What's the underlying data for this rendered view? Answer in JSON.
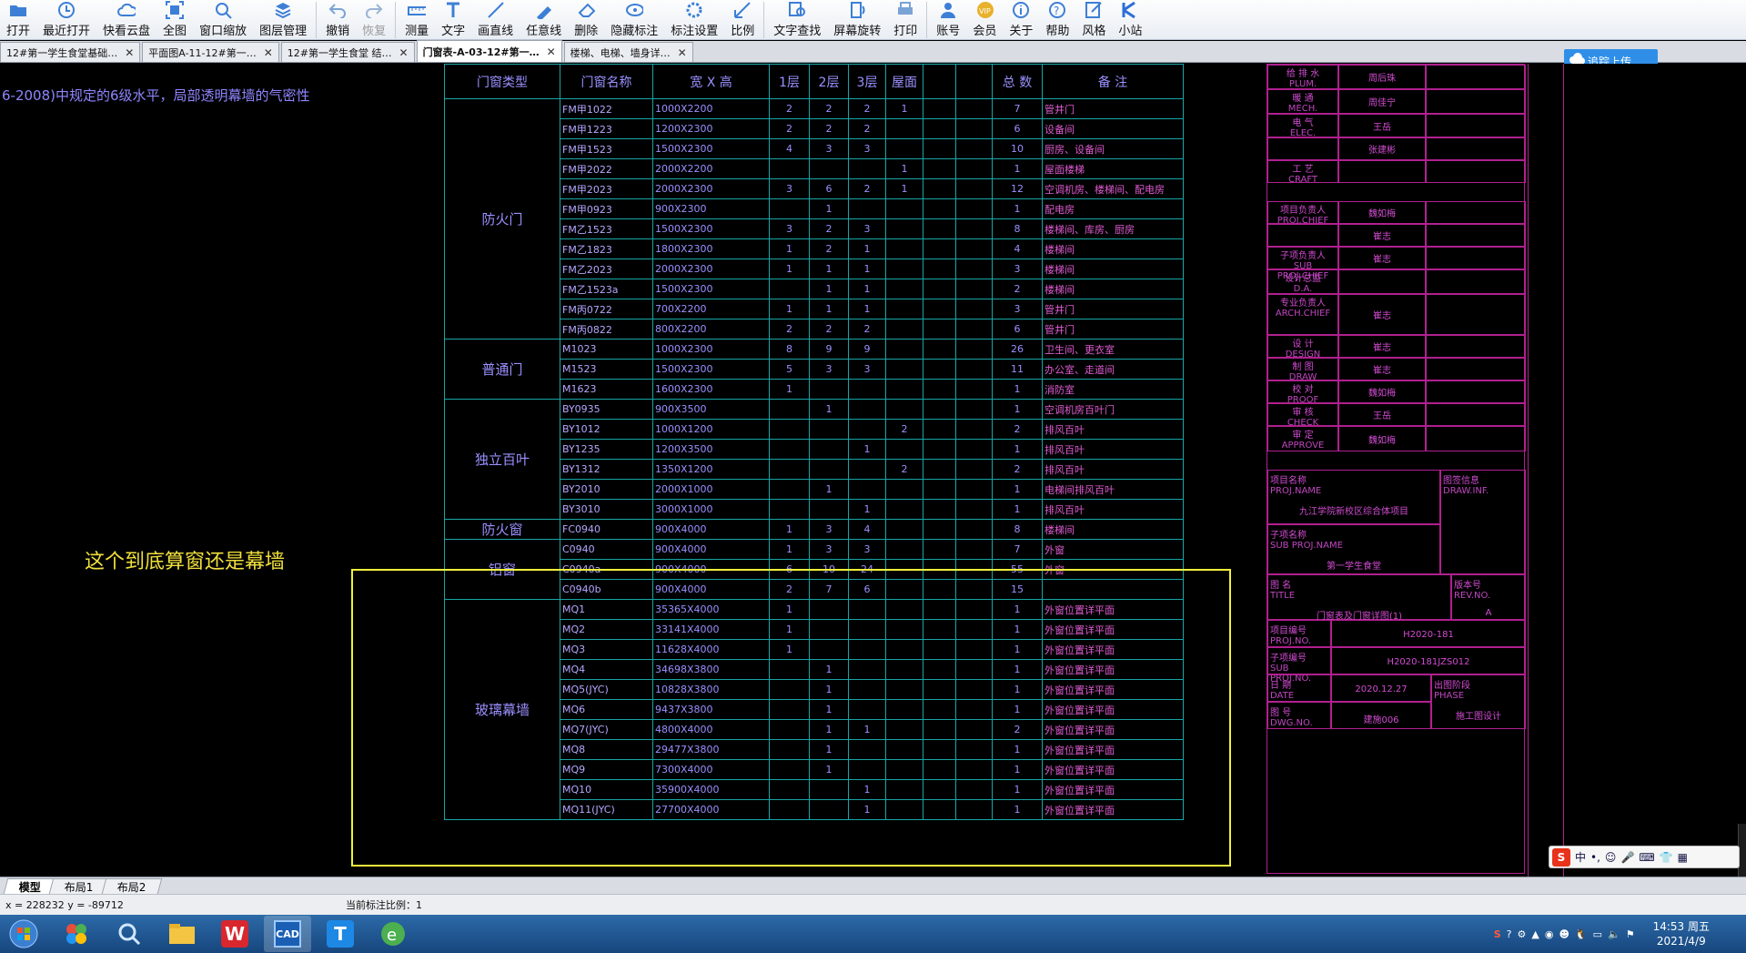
{
  "toolbar": {
    "items": [
      {
        "label": "打开",
        "icon": "folder-open-icon"
      },
      {
        "label": "最近打开",
        "icon": "recent-icon"
      },
      {
        "label": "快看云盘",
        "icon": "cloud-drive-icon"
      },
      {
        "label": "全图",
        "icon": "fit-all-icon"
      },
      {
        "label": "窗口缩放",
        "icon": "zoom-window-icon"
      },
      {
        "label": "图层管理",
        "icon": "layers-icon"
      },
      {
        "label": "撤销",
        "icon": "undo-icon"
      },
      {
        "label": "恢复",
        "icon": "redo-icon"
      },
      {
        "label": "测量",
        "icon": "measure-icon"
      },
      {
        "label": "文字",
        "icon": "text-icon"
      },
      {
        "label": "画直线",
        "icon": "line-icon"
      },
      {
        "label": "任意线",
        "icon": "freehand-icon"
      },
      {
        "label": "删除",
        "icon": "eraser-icon"
      },
      {
        "label": "隐藏标注",
        "icon": "hide-annotation-icon"
      },
      {
        "label": "标注设置",
        "icon": "annotation-settings-icon"
      },
      {
        "label": "比例",
        "icon": "scale-icon"
      },
      {
        "label": "文字查找",
        "icon": "text-search-icon"
      },
      {
        "label": "屏幕旋转",
        "icon": "rotate-screen-icon"
      },
      {
        "label": "打印",
        "icon": "print-icon"
      },
      {
        "label": "账号",
        "icon": "account-icon"
      },
      {
        "label": "会员",
        "icon": "vip-icon"
      },
      {
        "label": "关于",
        "icon": "info-icon"
      },
      {
        "label": "帮助",
        "icon": "help-icon"
      },
      {
        "label": "风格",
        "icon": "style-icon"
      },
      {
        "label": "小站",
        "icon": "site-icon"
      }
    ]
  },
  "tabs": [
    {
      "label": "12#第一学生食堂基础…",
      "close": "✕"
    },
    {
      "label": "平面图A-11-12#第一…",
      "close": "✕"
    },
    {
      "label": "12#第一学生食堂 结…",
      "close": "✕"
    },
    {
      "label": "门窗表-A-03-12#第一…",
      "close": "✕",
      "active": true
    },
    {
      "label": "楼梯、电梯、墙身详…",
      "close": "✕"
    }
  ],
  "cloud_button": {
    "label": "追踪上传"
  },
  "drawing": {
    "left_note": "6-2008)中规定的6级水平，局部透明幕墙的气密性",
    "annotation": "这个到底算窗还是幕墙",
    "table_headers": [
      "门窗类型",
      "门窗名称",
      "宽 X 高",
      "1层",
      "2层",
      "3层",
      "屋面",
      "",
      "",
      "总 数",
      "备 注"
    ],
    "rows": [
      {
        "name": "FM甲1022",
        "size": "1000X2200",
        "l1": "2",
        "l2": "2",
        "l3": "2",
        "roof": "1",
        "total": "7",
        "remark": "管井门"
      },
      {
        "name": "FM甲1223",
        "size": "1200X2300",
        "l1": "2",
        "l2": "2",
        "l3": "2",
        "roof": "",
        "total": "6",
        "remark": "设备间"
      },
      {
        "name": "FM甲1523",
        "size": "1500X2300",
        "l1": "4",
        "l2": "3",
        "l3": "3",
        "roof": "",
        "total": "10",
        "remark": "厨房、设备间"
      },
      {
        "name": "FM甲2022",
        "size": "2000X2200",
        "l1": "",
        "l2": "",
        "l3": "",
        "roof": "1",
        "total": "1",
        "remark": "屋面楼梯"
      },
      {
        "name": "FM甲2023",
        "size": "2000X2300",
        "l1": "3",
        "l2": "6",
        "l3": "2",
        "roof": "1",
        "total": "12",
        "remark": "空调机房、楼梯间、配电房"
      },
      {
        "name": "FM甲0923",
        "size": "900X2300",
        "l1": "",
        "l2": "1",
        "l3": "",
        "roof": "",
        "total": "1",
        "remark": "配电房"
      },
      {
        "name": "FM乙1523",
        "size": "1500X2300",
        "l1": "3",
        "l2": "2",
        "l3": "3",
        "roof": "",
        "total": "8",
        "remark": "楼梯间、库房、厨房"
      },
      {
        "name": "FM乙1823",
        "size": "1800X2300",
        "l1": "1",
        "l2": "2",
        "l3": "1",
        "roof": "",
        "total": "4",
        "remark": "楼梯间"
      },
      {
        "name": "FM乙2023",
        "size": "2000X2300",
        "l1": "1",
        "l2": "1",
        "l3": "1",
        "roof": "",
        "total": "3",
        "remark": "楼梯间"
      },
      {
        "name": "FM乙1523a",
        "size": "1500X2300",
        "l1": "",
        "l2": "1",
        "l3": "1",
        "roof": "",
        "total": "2",
        "remark": "楼梯间"
      },
      {
        "name": "FM丙0722",
        "size": "700X2200",
        "l1": "1",
        "l2": "1",
        "l3": "1",
        "roof": "",
        "total": "3",
        "remark": "管井门"
      },
      {
        "name": "FM丙0822",
        "size": "800X2200",
        "l1": "2",
        "l2": "2",
        "l3": "2",
        "roof": "",
        "total": "6",
        "remark": "管井门"
      },
      {
        "name": "M1023",
        "size": "1000X2300",
        "l1": "8",
        "l2": "9",
        "l3": "9",
        "roof": "",
        "total": "26",
        "remark": "卫生间、更衣室"
      },
      {
        "name": "M1523",
        "size": "1500X2300",
        "l1": "5",
        "l2": "3",
        "l3": "3",
        "roof": "",
        "total": "11",
        "remark": "办公室、走道间"
      },
      {
        "name": "M1623",
        "size": "1600X2300",
        "l1": "1",
        "l2": "",
        "l3": "",
        "roof": "",
        "total": "1",
        "remark": "消防室"
      },
      {
        "name": "BY0935",
        "size": "900X3500",
        "l1": "",
        "l2": "1",
        "l3": "",
        "roof": "",
        "total": "1",
        "remark": "空调机房百叶门"
      },
      {
        "name": "BY1012",
        "size": "1000X1200",
        "l1": "",
        "l2": "",
        "l3": "",
        "roof": "2",
        "total": "2",
        "remark": "排风百叶"
      },
      {
        "name": "BY1235",
        "size": "1200X3500",
        "l1": "",
        "l2": "",
        "l3": "1",
        "roof": "",
        "total": "1",
        "remark": "排风百叶"
      },
      {
        "name": "BY1312",
        "size": "1350X1200",
        "l1": "",
        "l2": "",
        "l3": "",
        "roof": "2",
        "total": "2",
        "remark": "排风百叶"
      },
      {
        "name": "BY2010",
        "size": "2000X1000",
        "l1": "",
        "l2": "1",
        "l3": "",
        "roof": "",
        "total": "1",
        "remark": "电梯间排风百叶"
      },
      {
        "name": "BY3010",
        "size": "3000X1000",
        "l1": "",
        "l2": "",
        "l3": "1",
        "roof": "",
        "total": "1",
        "remark": "排风百叶"
      },
      {
        "name": "FC0940",
        "size": "900X4000",
        "l1": "1",
        "l2": "3",
        "l3": "4",
        "roof": "",
        "total": "8",
        "remark": "楼梯间"
      },
      {
        "name": "C0940",
        "size": "900X4000",
        "l1": "1",
        "l2": "3",
        "l3": "3",
        "roof": "",
        "total": "7",
        "remark": "外窗"
      },
      {
        "name": "C0940a",
        "size": "900X4000",
        "l1": "6",
        "l2": "10",
        "l3": "24",
        "roof": "",
        "total": "55",
        "remark": "外窗"
      },
      {
        "name": "C0940b",
        "size": "900X4000",
        "l1": "2",
        "l2": "7",
        "l3": "6",
        "roof": "",
        "total": "15",
        "remark": ""
      },
      {
        "name": "MQ1",
        "size": "35365X4000",
        "l1": "1",
        "l2": "",
        "l3": "",
        "roof": "",
        "total": "1",
        "remark": "外窗位置详平面"
      },
      {
        "name": "MQ2",
        "size": "33141X4000",
        "l1": "1",
        "l2": "",
        "l3": "",
        "roof": "",
        "total": "1",
        "remark": "外窗位置详平面"
      },
      {
        "name": "MQ3",
        "size": "11628X4000",
        "l1": "1",
        "l2": "",
        "l3": "",
        "roof": "",
        "total": "1",
        "remark": "外窗位置详平面"
      },
      {
        "name": "MQ4",
        "size": "34698X3800",
        "l1": "",
        "l2": "1",
        "l3": "",
        "roof": "",
        "total": "1",
        "remark": "外窗位置详平面"
      },
      {
        "name": "MQ5(JYC)",
        "size": "10828X3800",
        "l1": "",
        "l2": "1",
        "l3": "",
        "roof": "",
        "total": "1",
        "remark": "外窗位置详平面"
      },
      {
        "name": "MQ6",
        "size": "9437X3800",
        "l1": "",
        "l2": "1",
        "l3": "",
        "roof": "",
        "total": "1",
        "remark": "外窗位置详平面"
      },
      {
        "name": "MQ7(JYC)",
        "size": "4800X4000",
        "l1": "",
        "l2": "1",
        "l3": "1",
        "roof": "",
        "total": "2",
        "remark": "外窗位置详平面"
      },
      {
        "name": "MQ8",
        "size": "29477X3800",
        "l1": "",
        "l2": "1",
        "l3": "",
        "roof": "",
        "total": "1",
        "remark": "外窗位置详平面"
      },
      {
        "name": "MQ9",
        "size": "7300X4000",
        "l1": "",
        "l2": "1",
        "l3": "",
        "roof": "",
        "total": "1",
        "remark": "外窗位置详平面"
      },
      {
        "name": "MQ10",
        "size": "35900X4000",
        "l1": "",
        "l2": "",
        "l3": "1",
        "roof": "",
        "total": "1",
        "remark": "外窗位置详平面"
      },
      {
        "name": "MQ11(JYC)",
        "size": "27700X4000",
        "l1": "",
        "l2": "",
        "l3": "1",
        "roof": "",
        "total": "1",
        "remark": "外窗位置详平面"
      }
    ],
    "categories": [
      {
        "label": "防火门",
        "rows": 12
      },
      {
        "label": "普通门",
        "rows": 3
      },
      {
        "label": "独立百叶",
        "rows": 6
      },
      {
        "label": "防火窗",
        "rows": 1
      },
      {
        "label": "铝窗",
        "rows": 3
      },
      {
        "label": "玻璃幕墙",
        "rows": 11
      }
    ],
    "title_block": {
      "cells": [
        {
          "cn": "给 排 水",
          "en": "PLUM.",
          "val": "周后珠"
        },
        {
          "cn": "暖 通",
          "en": "MECH.",
          "val": "周佳宁"
        },
        {
          "cn": "电 气",
          "en": "ELEC.",
          "val": "王岳"
        },
        {
          "cn": "",
          "en": "",
          "val": "张建彬"
        },
        {
          "cn": "工 艺",
          "en": "CRAFT",
          "val": ""
        },
        {
          "cn": "项目负责人",
          "en": "PROJ.CHIEF",
          "val": "魏如梅"
        },
        {
          "cn": "",
          "en": "",
          "val": "崔志"
        },
        {
          "cn": "子项负责人",
          "en": "SUB PROJ.CHIEF",
          "val": "崔志"
        },
        {
          "cn": "设计总监",
          "en": "D.A.",
          "val": ""
        },
        {
          "cn": "专业负责人",
          "en": "ARCH.CHIEF",
          "val": "崔志"
        },
        {
          "cn": "设 计",
          "en": "DESIGN",
          "val": "崔志"
        },
        {
          "cn": "制 图",
          "en": "DRAW",
          "val": "崔志"
        },
        {
          "cn": "校 对",
          "en": "PROOF",
          "val": "魏如梅"
        },
        {
          "cn": "审 核",
          "en": "CHECK",
          "val": "王岳"
        },
        {
          "cn": "审 定",
          "en": "APPROVE",
          "val": "魏如梅"
        }
      ],
      "proj_name_cn": "项目名称",
      "proj_name_en": "PROJ.NAME",
      "proj_name_val": "九江学院新校区综合体项目",
      "draw_inf_cn": "图签信息",
      "draw_inf_en": "DRAW.INF.",
      "subproj_cn": "子项名称",
      "subproj_en": "SUB PROJ.NAME",
      "subproj_val": "第一学生食堂",
      "title_cn": "图 名",
      "title_en": "TITLE",
      "title_val": "门窗表及门窗详图(1)",
      "rev_cn": "版本号",
      "rev_en": "REV.NO.",
      "rev_val": "A",
      "projno_cn": "项目编号",
      "projno_en": "PROJ.NO.",
      "projno_val": "H2020-181",
      "subprojno_cn": "子项编号",
      "subprojno_en": "SUB PROJ.NO.",
      "subprojno_val": "H2020-181JZS012",
      "date_cn": "日 期",
      "date_en": "DATE",
      "date_val": "2020.12.27",
      "phase_cn": "出图阶段",
      "phase_en": "PHASE",
      "phase_val": "施工图设计",
      "dwgno_cn": "图 号",
      "dwgno_en": "DWG.NO.",
      "dwgno_val": "建施006"
    }
  },
  "layout_tabs": [
    "模型",
    "布局1",
    "布局2"
  ],
  "status": {
    "coords": "x = 228232  y = -89712",
    "scale": "当前标注比例：1"
  },
  "ime": {
    "label": "中"
  },
  "clock": {
    "time": "14:53 周五",
    "date": "2021/4/9"
  },
  "colors": {
    "accent": "#2f8fe8",
    "table_line": "#18a6a6",
    "text": "#9a90ff",
    "titleblock": "#b0208f",
    "annotation": "#f0e03c"
  }
}
